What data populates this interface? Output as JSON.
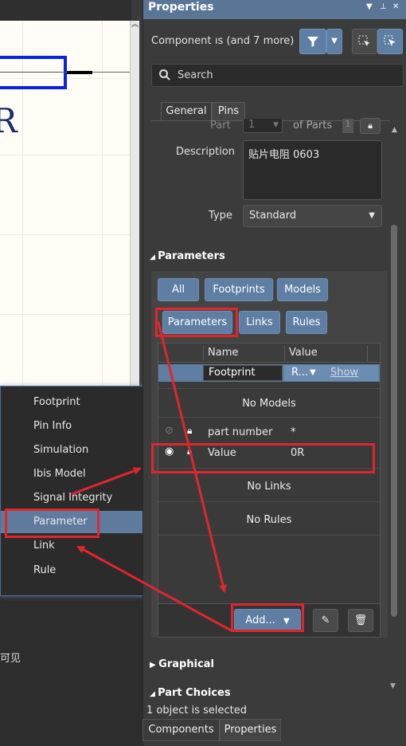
{
  "context_menu": {
    "items": [
      {
        "label": "Footprint",
        "highlighted": false
      },
      {
        "label": "Pin Info",
        "highlighted": false
      },
      {
        "label": "Simulation",
        "highlighted": false
      },
      {
        "label": "Ibis Model",
        "highlighted": false
      },
      {
        "label": "Signal Integrity",
        "highlighted": false
      },
      {
        "label": "Parameter",
        "highlighted": true
      },
      {
        "label": "Link",
        "highlighted": false
      },
      {
        "label": "Rule",
        "highlighted": false
      }
    ]
  },
  "canvas": {
    "designator_fragment": "R",
    "bottom_text_fragment": "可见"
  },
  "properties": {
    "title": "Properties",
    "component_filter_label": "Component",
    "component_filter_value": "ıs (and 7 more)",
    "search_placeholder": "Search",
    "tabs": [
      "General",
      "Pins"
    ],
    "part_label": "Part",
    "part_value": "1",
    "of_parts_label": "of Parts",
    "of_parts_value": "1",
    "description_label": "Description",
    "description_value": "贴片电阻 0603",
    "type_label": "Type",
    "type_value": "Standard",
    "parameters_section": "Parameters",
    "filter_buttons": [
      "All",
      "Footprints",
      "Models",
      "Parameters",
      "Links",
      "Rules"
    ],
    "table": {
      "col_name": "Name",
      "col_value": "Value",
      "footprint_row": {
        "name": "Footprint",
        "value": "R...",
        "show_label": "Show"
      },
      "no_models": "No Models",
      "param_rows": [
        {
          "name": "part number",
          "value": "*",
          "visible": false
        },
        {
          "name": "Value",
          "value": "0R",
          "visible": true
        }
      ],
      "no_links": "No Links",
      "no_rules": "No Rules"
    },
    "add_button": "Add...",
    "graphical_section": "Graphical",
    "part_choices_section": "Part Choices",
    "status_text": "1 object is selected",
    "bottom_tabs": [
      "Components",
      "Properties"
    ]
  },
  "colors": {
    "accent_blue": "#5e7ea4",
    "annotation_red": "#e0262b",
    "panel_bg": "#3b3b3b"
  }
}
